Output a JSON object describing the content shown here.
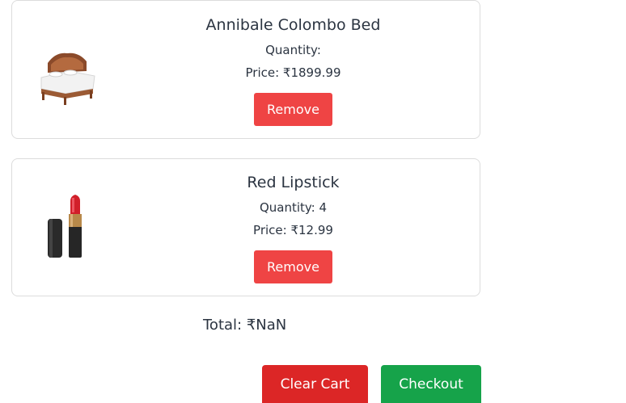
{
  "cart": {
    "items": [
      {
        "title": "Annibale Colombo Bed",
        "quantity_text": "Quantity:",
        "price_text": "Price: ₹1899.99",
        "remove_label": "Remove"
      },
      {
        "title": "Red Lipstick",
        "quantity_text": "Quantity: 4",
        "price_text": "Price: ₹12.99",
        "remove_label": "Remove"
      }
    ],
    "total_text": "Total: ₹NaN",
    "clear_label": "Clear Cart",
    "checkout_label": "Checkout"
  },
  "colors": {
    "remove": "#ef4444",
    "clear": "#dc2626",
    "checkout": "#16a34a"
  },
  "icons": [
    "bed-image",
    "lipstick-image"
  ]
}
